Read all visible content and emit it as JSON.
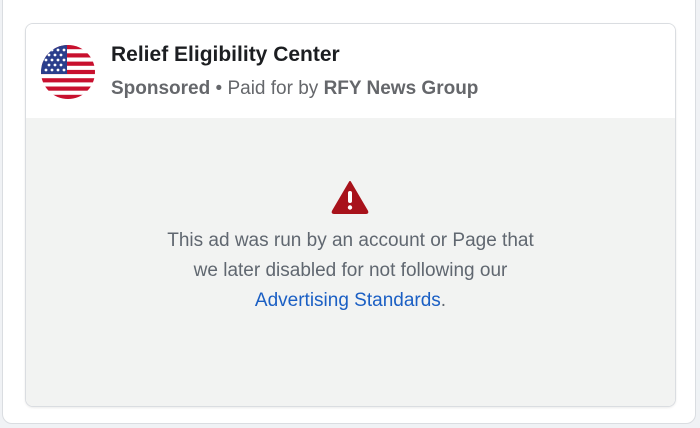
{
  "ad": {
    "page_name": "Relief Eligibility Center",
    "sponsored_label": "Sponsored",
    "separator": " • ",
    "paid_for_label": "Paid for by ",
    "funder": "RFY News Group",
    "avatar_icon": "us-flag-icon",
    "warning_icon": "warning-triangle-icon",
    "message_line1": "This ad was run by an account or Page that",
    "message_line2": "we later disabled for not following our",
    "link_text": "Advertising Standards",
    "link_suffix": ".",
    "colors": {
      "link": "#1b5fc4",
      "warning": "#a8121b",
      "body_bg": "#f2f3f2",
      "text_secondary": "#606770"
    }
  }
}
